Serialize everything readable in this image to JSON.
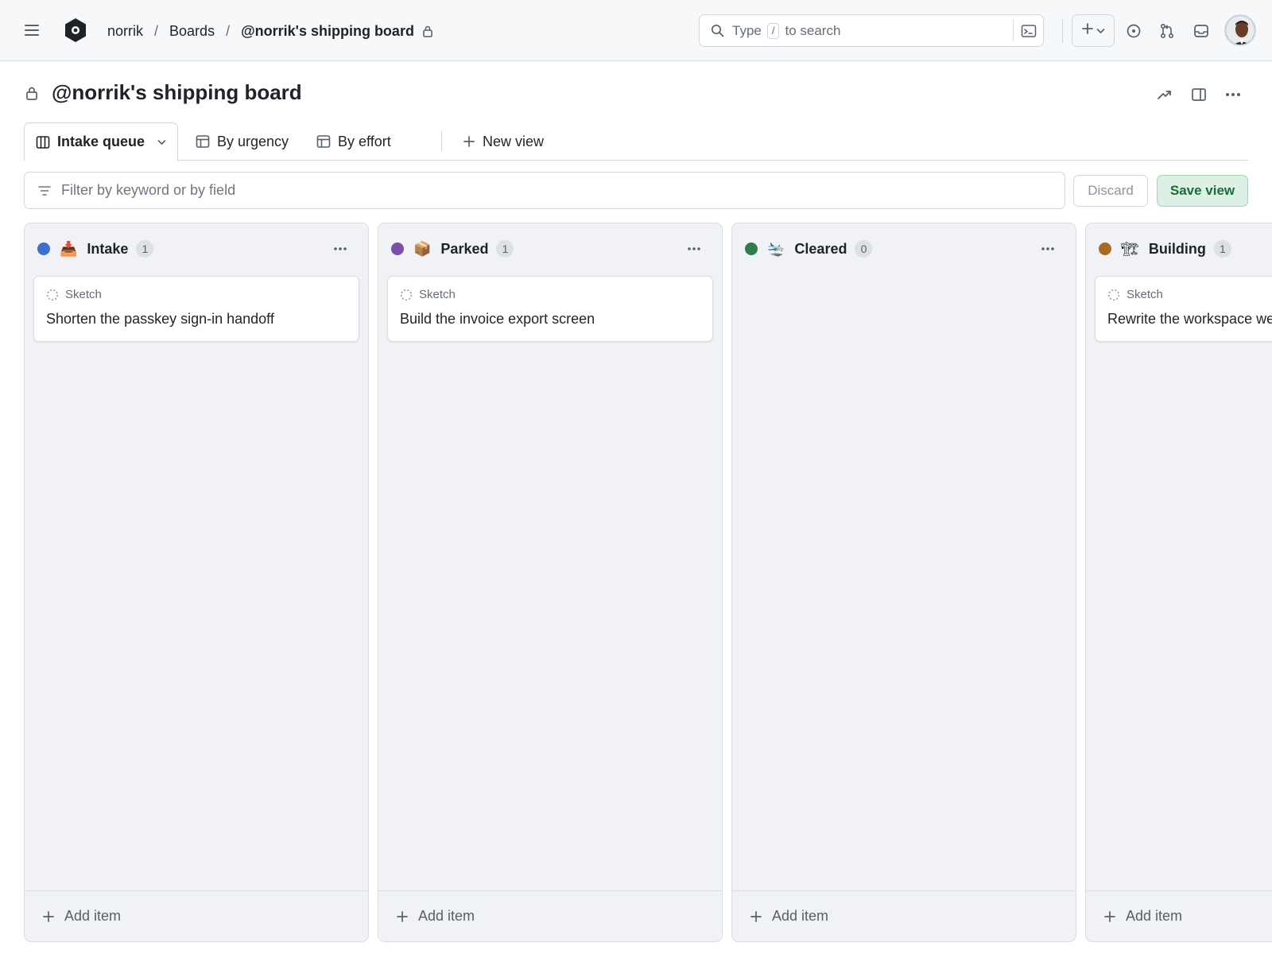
{
  "header": {
    "breadcrumbs": [
      "norrik",
      "Boards",
      "@norrik's shipping board"
    ],
    "separator": "/",
    "search": {
      "prefix": "Type",
      "key": "/",
      "suffix": "to search"
    },
    "icons": [
      "hamburger-icon",
      "logo-icon",
      "lock-icon",
      "search-icon",
      "command-palette-icon",
      "plus-icon",
      "chevron-down-icon",
      "issues-icon",
      "pull-requests-icon",
      "inbox-icon",
      "avatar"
    ]
  },
  "page": {
    "title": "@norrik's shipping board",
    "actions": [
      "insights-icon",
      "side-panel-icon",
      "more-icon"
    ]
  },
  "views": {
    "tabs": [
      {
        "label": "Intake queue",
        "icon": "board-icon",
        "active": true
      },
      {
        "label": "By urgency",
        "icon": "table-icon",
        "active": false
      },
      {
        "label": "By effort",
        "icon": "table-icon",
        "active": false
      }
    ],
    "new_view": "New view"
  },
  "filter": {
    "placeholder": "Filter by keyword or by field",
    "discard": "Discard",
    "save": "Save view"
  },
  "columns": [
    {
      "name": "Intake",
      "emoji": "📥",
      "count": "1",
      "color": "#3b6fd0",
      "cards": [
        {
          "type": "Sketch",
          "title": "Shorten the passkey sign-in handoff"
        }
      ],
      "add": "Add item"
    },
    {
      "name": "Parked",
      "emoji": "📦",
      "count": "1",
      "color": "#7b4fa8",
      "cards": [
        {
          "type": "Sketch",
          "title": "Build the invoice export screen"
        }
      ],
      "add": "Add item"
    },
    {
      "name": "Cleared",
      "emoji": "🛬",
      "count": "0",
      "color": "#2f7d4f",
      "cards": [],
      "add": "Add item"
    },
    {
      "name": "Building",
      "emoji": "🏗",
      "count": "1",
      "color": "#a86b20",
      "cards": [
        {
          "type": "Sketch",
          "title": "Rewrite the workspace we"
        }
      ],
      "add": "Add item"
    }
  ],
  "colors": {
    "accent_green": "#1a6c3b",
    "save_bg": "#dcf0e3",
    "board_bg": "#f0f2f5"
  }
}
